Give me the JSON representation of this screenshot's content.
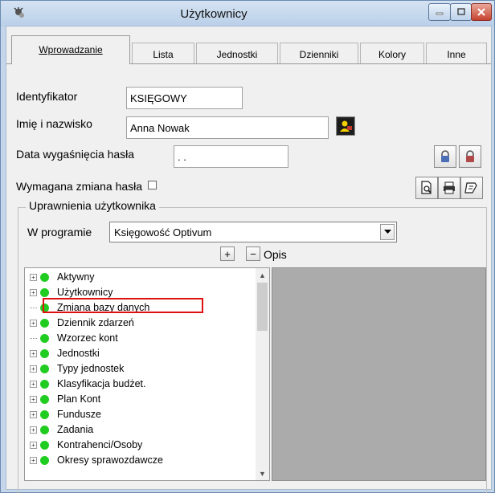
{
  "window": {
    "title": "Użytkownicy",
    "accent_close": "#c6432f"
  },
  "tabs": [
    {
      "label": "Wprowadzanie",
      "active": true
    },
    {
      "label": "Lista"
    },
    {
      "label": "Jednostki"
    },
    {
      "label": "Dzienniki"
    },
    {
      "label": "Kolory"
    },
    {
      "label": "Inne"
    }
  ],
  "form": {
    "id_label": "Identyfikator",
    "id_value": "KSIĘGOWY",
    "name_label": "Imię i nazwisko",
    "name_value": "Anna Nowak",
    "expiry_label": "Data wygaśnięcia hasła",
    "expiry_value": " . .",
    "change_label": "Wymagana zmiana hasła",
    "change_checked": false
  },
  "permissions": {
    "group_title": "Uprawnienia użytkownika",
    "program_label": "W programie",
    "program_value": "Księgowość Optivum",
    "expand_symbol": "+",
    "collapse_symbol": "−",
    "desc_label": "Opis",
    "items": [
      {
        "label": "Aktywny",
        "expandable": true
      },
      {
        "label": "Użytkownicy",
        "expandable": true
      },
      {
        "label": "Zmiana bazy danych",
        "expandable": false,
        "highlighted": true
      },
      {
        "label": "Dziennik zdarzeń",
        "expandable": true
      },
      {
        "label": "Wzorzec kont",
        "expandable": false
      },
      {
        "label": "Jednostki",
        "expandable": true
      },
      {
        "label": "Typy jednostek",
        "expandable": true
      },
      {
        "label": "Klasyfikacja budżet.",
        "expandable": true
      },
      {
        "label": "Plan Kont",
        "expandable": true
      },
      {
        "label": "Fundusze",
        "expandable": true
      },
      {
        "label": "Zadania",
        "expandable": true
      },
      {
        "label": "Kontrahenci/Osoby",
        "expandable": true
      },
      {
        "label": "Okresy sprawozdawcze",
        "expandable": true
      }
    ],
    "status_color": "#21cc21",
    "highlight_color": "#e01010"
  }
}
